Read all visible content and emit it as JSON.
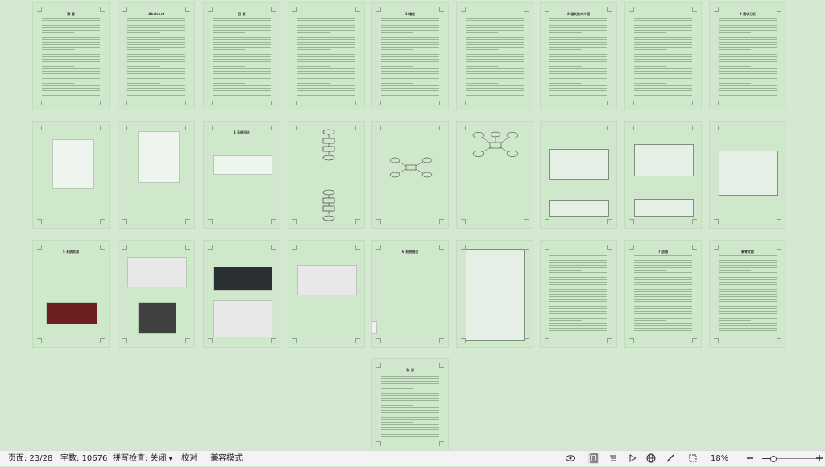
{
  "document": {
    "page_titles": [
      "摘 要",
      "Abstract",
      "目 录",
      "",
      "1 绪论",
      "",
      "2 相关技术介绍",
      "",
      "3 需求分析",
      "",
      "",
      "4 系统设计",
      "",
      "",
      "",
      "",
      "",
      "",
      "5 系统实现",
      "",
      "",
      "",
      "6 系统测试",
      "",
      "",
      "7 总结",
      "参考文献",
      "致 谢"
    ]
  },
  "statusbar": {
    "page": "页面: 23/28",
    "words": "字数: 10676",
    "spell": "拼写检查: 关闭",
    "spell_caret": "▾",
    "proof": "校对",
    "compat": "兼容模式",
    "zoom": "18%",
    "zoom_level": 0.18,
    "icons": [
      "eye-icon",
      "page-view-icon",
      "outline-icon",
      "play-icon",
      "globe-icon",
      "pen-icon",
      "fit-screen-icon",
      "zoom-out-icon",
      "zoom-in-icon"
    ]
  }
}
